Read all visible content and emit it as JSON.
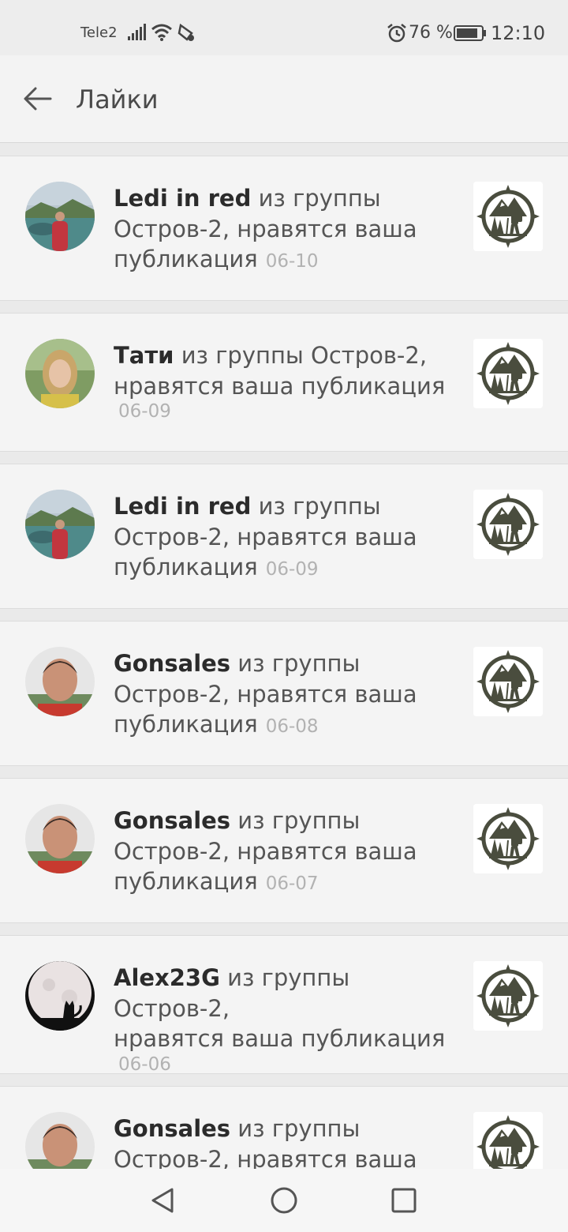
{
  "status_bar": {
    "carrier": "Tele2",
    "battery": "76 %",
    "time": "12:10",
    "icons": [
      "signal-icon",
      "wifi-icon",
      "nfc-icon",
      "alarm-icon",
      "battery-icon"
    ]
  },
  "header": {
    "back_icon": "arrow-left-icon",
    "title": "Лайки"
  },
  "notifications": [
    {
      "user": "Ledi in red",
      "text_a": " из группы",
      "text_b": "Остров-2, нравятся ваша",
      "text_c": "публикация",
      "date": "06-10"
    },
    {
      "user": "Тати",
      "text_a": " из группы Остров-2,",
      "text_b": "нравятся ваша публикация",
      "date": "06-09"
    },
    {
      "user": "Ledi in red",
      "text_a": " из группы",
      "text_b": "Остров-2, нравятся ваша",
      "text_c": "публикация",
      "date": "06-09"
    },
    {
      "user": "Gonsales",
      "text_a": " из группы",
      "text_b": "Остров-2, нравятся ваша",
      "text_c": "публикация",
      "date": "06-08"
    },
    {
      "user": "Gonsales",
      "text_a": " из группы",
      "text_b": "Остров-2, нравятся ваша",
      "text_c": "публикация",
      "date": "06-07"
    },
    {
      "user": "Alex23G",
      "text_a": " из группы Остров-2,",
      "text_b": "нравятся ваша публикация",
      "date": "06-06"
    },
    {
      "user": "Gonsales",
      "text_a": " из группы",
      "text_b": "Остров-2, нравятся ваша"
    }
  ],
  "nav_bar": {
    "icons": [
      "nav-back-icon",
      "nav-home-icon",
      "nav-recents-icon"
    ]
  },
  "colors": {
    "background": "#eaeaea",
    "card": "#f4f4f4",
    "emblem": "#4a4d3e",
    "timestamp": "#b2b2b2"
  }
}
